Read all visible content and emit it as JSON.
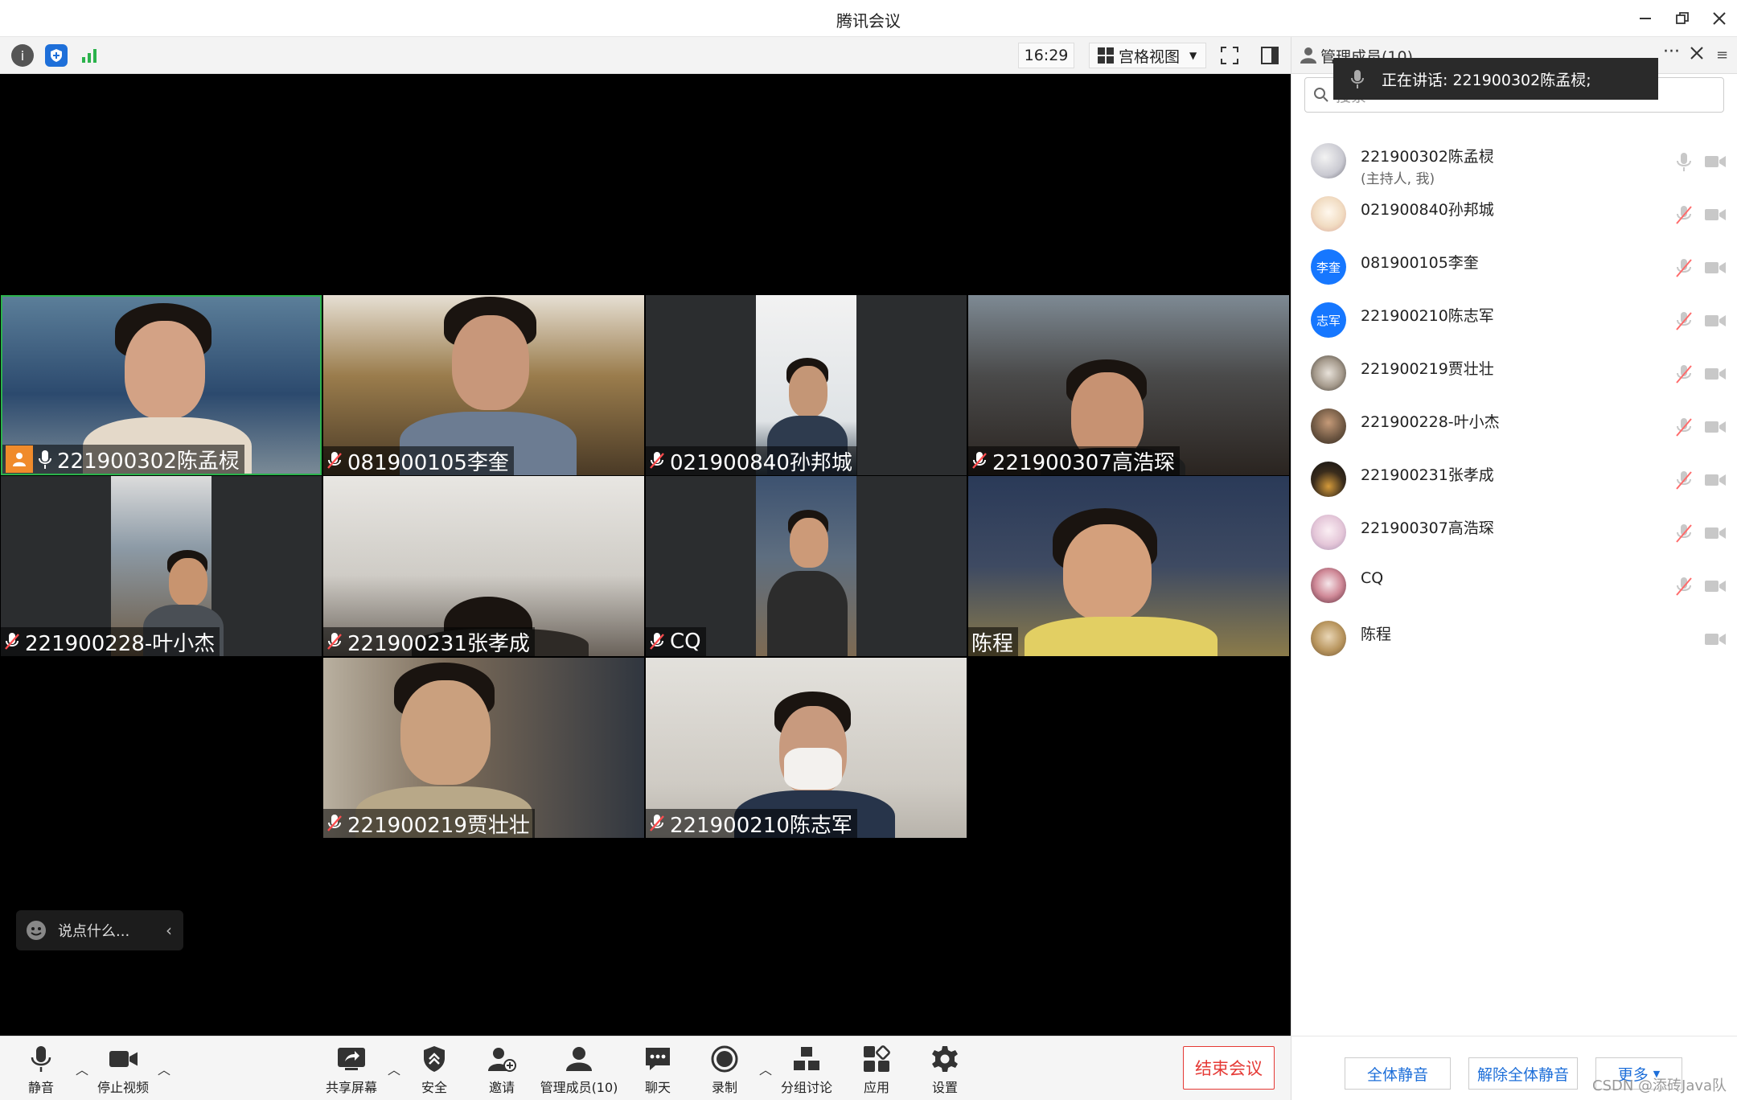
{
  "window": {
    "title": "腾讯会议"
  },
  "topbar": {
    "time": "16:29",
    "view_label": "宫格视图"
  },
  "video_tiles": [
    {
      "name": "221900302陈孟棂",
      "host": true,
      "muted": false
    },
    {
      "name": "081900105李奎",
      "muted": true
    },
    {
      "name": "021900840孙邦城",
      "muted": true
    },
    {
      "name": "221900307高浩琛",
      "muted": true
    },
    {
      "name": "221900228-叶小杰",
      "muted": true
    },
    {
      "name": "221900231张孝成",
      "muted": true
    },
    {
      "name": "CQ",
      "muted": true
    },
    {
      "name": "陈程",
      "muted": false
    },
    {
      "name": "221900219贾壮壮",
      "muted": true
    },
    {
      "name": "221900210陈志军",
      "muted": true
    }
  ],
  "chat": {
    "placeholder": "说点什么..."
  },
  "toolbar": {
    "mute": "静音",
    "stop_video": "停止视频",
    "share": "共享屏幕",
    "security": "安全",
    "invite": "邀请",
    "manage": "管理成员(10)",
    "chat": "聊天",
    "record": "录制",
    "breakout": "分组讨论",
    "apps": "应用",
    "settings": "设置",
    "end": "结束会议"
  },
  "panel": {
    "title": "管理成员(10)",
    "speaking": "正在讲话: 221900302陈孟棂;",
    "search_placeholder": "搜索",
    "members": [
      {
        "name": "221900302陈孟棂",
        "sub": "(主持人, 我)",
        "avatar": "anime",
        "mic": "on"
      },
      {
        "name": "021900840孙邦城",
        "avatar": "cat",
        "mic": "off"
      },
      {
        "name": "081900105李奎",
        "avatar_text": "李奎",
        "avatar": "text",
        "mic": "off"
      },
      {
        "name": "221900210陈志军",
        "avatar_text": "志军",
        "avatar": "text",
        "mic": "off"
      },
      {
        "name": "221900219贾壮壮",
        "avatar": "cat2",
        "mic": "off"
      },
      {
        "name": "221900228-叶小杰",
        "avatar": "photo",
        "mic": "off"
      },
      {
        "name": "221900231张孝成",
        "avatar": "night",
        "mic": "off"
      },
      {
        "name": "221900307高浩琛",
        "avatar": "anime2",
        "mic": "off"
      },
      {
        "name": "CQ",
        "avatar": "anime3",
        "mic": "off"
      },
      {
        "name": "陈程",
        "avatar": "dog",
        "mic": "none"
      }
    ],
    "mute_all": "全体静音",
    "unmute_all": "解除全体静音",
    "more": "更多"
  },
  "watermark": "CSDN @添砖Java队",
  "colors": {
    "accent": "#1e6fd9",
    "end_red": "#e53935",
    "host_orange": "#f08b2b",
    "text_avatar": "#1677ff"
  }
}
